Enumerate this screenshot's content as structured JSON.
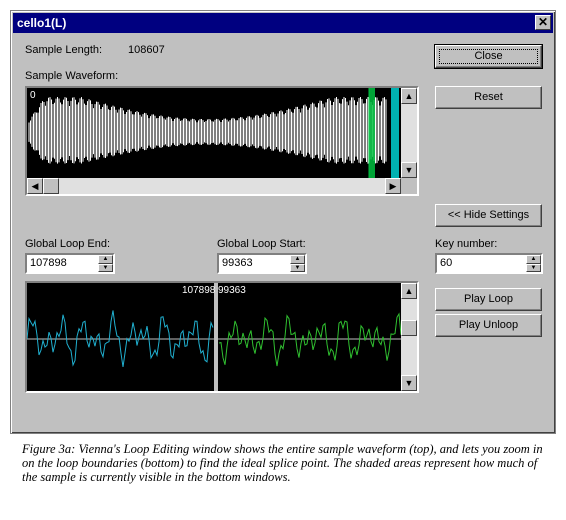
{
  "window": {
    "title": "cello1(L)",
    "close_glyph": "✕"
  },
  "sample_length": {
    "label": "Sample Length:",
    "value": "108607"
  },
  "waveform": {
    "label": "Sample Waveform:",
    "zero_label": "0",
    "loop_color": "#00c040",
    "visible_color": "#00d0d0"
  },
  "buttons": {
    "close": "Close",
    "reset": "Reset",
    "hide_settings": "<< Hide Settings",
    "play_loop": "Play Loop",
    "play_unloop": "Play Unloop"
  },
  "loop_end": {
    "label": "Global Loop End:",
    "value": "107898"
  },
  "loop_start": {
    "label": "Global Loop Start:",
    "value": "99363"
  },
  "key_number": {
    "label": "Key number:",
    "value": "60"
  },
  "zoom": {
    "end_marker": "107898",
    "start_marker": "99363",
    "left_color": "#20b0d0",
    "right_color": "#30c030"
  },
  "caption": "Figure 3a: Vienna's Loop Editing window shows the entire sample waveform (top), and lets you zoom in on the loop boundaries (bottom) to find the ideal splice point. The shaded areas represent how much of the sample is currently visible in the bottom windows."
}
